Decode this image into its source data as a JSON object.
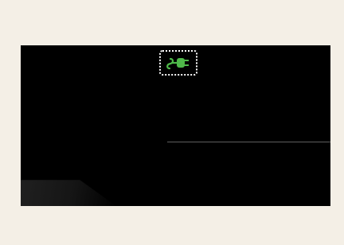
{
  "page": {
    "background": "#f4efe6",
    "screen_background": "#000000"
  },
  "indicator": {
    "icon": "ethernet-plug-icon",
    "icon_color": "#4fb94a",
    "highlight_style": "white dotted rounded outline"
  }
}
